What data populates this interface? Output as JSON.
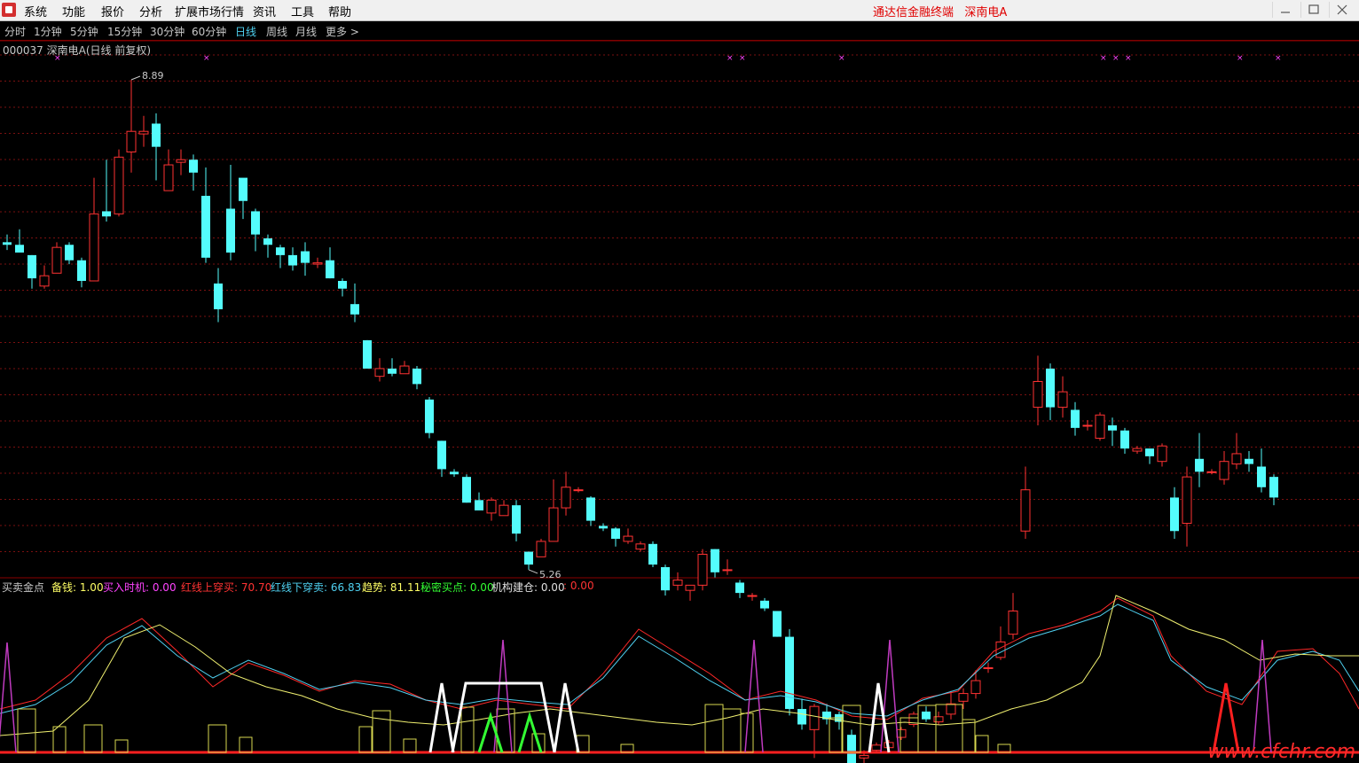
{
  "menu": {
    "items": [
      "系统",
      "功能",
      "报价",
      "分析",
      "扩展市场行情",
      "资讯",
      "工具",
      "帮助"
    ],
    "app_title": "通达信金融终端",
    "stock_title": "深南电A"
  },
  "periods": {
    "items": [
      "分时",
      "1分钟",
      "5分钟",
      "15分钟",
      "30分钟",
      "60分钟",
      "日线",
      "周线",
      "月线",
      "更多 >"
    ],
    "active": "日线"
  },
  "stock": {
    "code_name": "000037 深南电A(日线 前复权)",
    "high_label": "8.89",
    "low_label": "5.26"
  },
  "indicator": {
    "name": "买卖金点",
    "items": [
      {
        "label": "备钱:",
        "value": "1.00",
        "color": "#ffff66"
      },
      {
        "label": "买入时机:",
        "value": "0.00",
        "color": "#ff44ff"
      },
      {
        "label": "红线上穿买:",
        "value": "70.70",
        "color": "#ff3333"
      },
      {
        "label": "红线下穿卖:",
        "value": "66.83",
        "color": "#4fd0f0"
      },
      {
        "label": "趋势:",
        "value": "81.11",
        "color": "#ffff66"
      },
      {
        "label": "秘密买点:",
        "value": "0.00",
        "color": "#33ff33"
      },
      {
        "label": "机构建仓:",
        "value": "0.00",
        "color": "#e0e0e0"
      },
      {
        "label": ":",
        "value": "0.00",
        "color": "#ff3333"
      }
    ]
  },
  "chart_data": {
    "type": "candlestick",
    "ylim": [
      5.1,
      9.1
    ],
    "grid": true,
    "up_color": "#ff3232",
    "down_color": "#54fcfc",
    "candles": [
      [
        7.62,
        7.6,
        7.68,
        7.56
      ],
      [
        7.6,
        7.54,
        7.72,
        7.54
      ],
      [
        7.52,
        7.34,
        7.52,
        7.26
      ],
      [
        7.28,
        7.36,
        7.44,
        7.26
      ],
      [
        7.38,
        7.58,
        7.62,
        7.38
      ],
      [
        7.6,
        7.48,
        7.62,
        7.45
      ],
      [
        7.48,
        7.32,
        7.5,
        7.27
      ],
      [
        7.32,
        7.84,
        8.12,
        7.32
      ],
      [
        7.86,
        7.82,
        8.26,
        7.78
      ],
      [
        7.84,
        8.28,
        8.34,
        7.82
      ],
      [
        8.32,
        8.48,
        8.88,
        8.16
      ],
      [
        8.46,
        8.48,
        8.6,
        8.36
      ],
      [
        8.54,
        8.36,
        8.62,
        8.1
      ],
      [
        8.02,
        8.22,
        8.34,
        8.02
      ],
      [
        8.24,
        8.26,
        8.34,
        8.14
      ],
      [
        8.26,
        8.16,
        8.3,
        8.02
      ],
      [
        7.98,
        7.5,
        8.2,
        7.46
      ],
      [
        7.3,
        7.1,
        7.42,
        7.0
      ],
      [
        7.88,
        7.54,
        8.22,
        7.48
      ],
      [
        8.12,
        7.94,
        8.08,
        7.8
      ],
      [
        7.86,
        7.68,
        7.88,
        7.55
      ],
      [
        7.65,
        7.6,
        7.68,
        7.5
      ],
      [
        7.58,
        7.52,
        7.6,
        7.42
      ],
      [
        7.52,
        7.44,
        7.58,
        7.4
      ],
      [
        7.55,
        7.46,
        7.62,
        7.36
      ],
      [
        7.45,
        7.46,
        7.5,
        7.42
      ],
      [
        7.48,
        7.34,
        7.58,
        7.34
      ],
      [
        7.32,
        7.26,
        7.34,
        7.2
      ],
      [
        7.14,
        7.06,
        7.3,
        7.0
      ],
      [
        6.86,
        6.64,
        6.86,
        6.64
      ],
      [
        6.58,
        6.64,
        6.72,
        6.54
      ],
      [
        6.64,
        6.6,
        6.72,
        6.58
      ],
      [
        6.6,
        6.66,
        6.7,
        6.62
      ],
      [
        6.64,
        6.52,
        6.66,
        6.48
      ],
      [
        6.4,
        6.14,
        6.42,
        6.1
      ],
      [
        6.08,
        5.86,
        6.08,
        5.8
      ],
      [
        5.84,
        5.82,
        5.86,
        5.8
      ],
      [
        5.8,
        5.6,
        5.82,
        5.6
      ],
      [
        5.62,
        5.54,
        5.68,
        5.54
      ],
      [
        5.52,
        5.62,
        5.64,
        5.46
      ],
      [
        5.5,
        5.58,
        5.62,
        5.5
      ],
      [
        5.58,
        5.36,
        5.62,
        5.3
      ],
      [
        5.22,
        5.12,
        5.14,
        5.08
      ],
      [
        5.18,
        5.3,
        5.32,
        5.18
      ],
      [
        5.3,
        5.56,
        5.78,
        5.3
      ],
      [
        5.56,
        5.72,
        5.84,
        5.5
      ],
      [
        5.7,
        5.7,
        5.72,
        5.68
      ],
      [
        5.64,
        5.46,
        5.65,
        5.42
      ],
      [
        5.42,
        5.4,
        5.44,
        5.38
      ],
      [
        5.4,
        5.32,
        5.41,
        5.26
      ],
      [
        5.3,
        5.34,
        5.4,
        5.28
      ],
      [
        5.24,
        5.28,
        5.3,
        5.22
      ],
      [
        5.28,
        5.12,
        5.3,
        5.1
      ],
      [
        5.1,
        4.92,
        5.12,
        4.88
      ],
      [
        4.96,
        5.0,
        5.06,
        4.92
      ],
      [
        4.92,
        4.96,
        4.96,
        4.84
      ],
      [
        4.96,
        5.2,
        5.24,
        4.92
      ],
      [
        5.24,
        5.06,
        5.24,
        5.02
      ],
      [
        5.08,
        5.08,
        5.16,
        5.04
      ],
      [
        4.98,
        4.9,
        5.0,
        4.86
      ],
      [
        4.88,
        4.88,
        4.9,
        4.84
      ],
      [
        4.84,
        4.78,
        4.86,
        4.76
      ],
      [
        4.76,
        4.56,
        4.76,
        4.56
      ],
      [
        4.56,
        4.0,
        4.62,
        3.95
      ],
      [
        4.0,
        3.88,
        4.08,
        3.84
      ],
      [
        3.84,
        4.02,
        4.04,
        3.62
      ],
      [
        3.98,
        3.92,
        4.04,
        3.88
      ],
      [
        3.96,
        3.9,
        3.98,
        3.84
      ],
      [
        3.8,
        3.52,
        3.84,
        3.48
      ],
      [
        3.62,
        3.64,
        3.68,
        3.58
      ],
      [
        3.68,
        3.72,
        3.74,
        3.66
      ],
      [
        3.7,
        3.74,
        3.76,
        3.68
      ],
      [
        3.78,
        3.84,
        3.86,
        3.76
      ],
      [
        3.88,
        3.96,
        3.98,
        3.86
      ],
      [
        3.98,
        3.92,
        4.02,
        3.9
      ],
      [
        3.9,
        3.94,
        3.98,
        3.88
      ],
      [
        3.96,
        4.04,
        4.14,
        3.92
      ],
      [
        4.06,
        4.12,
        4.16,
        4.0
      ],
      [
        4.12,
        4.22,
        4.3,
        4.08
      ],
      [
        4.32,
        4.32,
        4.36,
        4.28
      ],
      [
        4.4,
        4.52,
        4.64,
        4.38
      ],
      [
        4.58,
        4.76,
        4.9,
        4.54
      ],
      [
        5.38,
        5.7,
        5.88,
        5.32
      ],
      [
        6.34,
        6.54,
        6.74,
        6.2
      ],
      [
        6.64,
        6.34,
        6.68,
        6.24
      ],
      [
        6.34,
        6.46,
        6.58,
        6.26
      ],
      [
        6.32,
        6.18,
        6.38,
        6.12
      ],
      [
        6.2,
        6.2,
        6.24,
        6.16
      ],
      [
        6.1,
        6.28,
        6.3,
        6.08
      ],
      [
        6.2,
        6.16,
        6.26,
        6.04
      ],
      [
        6.16,
        6.02,
        6.18,
        5.98
      ],
      [
        6.0,
        6.02,
        6.04,
        5.98
      ],
      [
        6.02,
        5.96,
        6.02,
        5.9
      ],
      [
        5.92,
        6.04,
        6.06,
        5.88
      ],
      [
        5.64,
        5.38,
        5.72,
        5.32
      ],
      [
        5.44,
        5.8,
        5.88,
        5.26
      ],
      [
        5.94,
        5.84,
        6.14,
        5.72
      ],
      [
        5.84,
        5.84,
        5.86,
        5.82
      ],
      [
        5.78,
        5.92,
        6.0,
        5.74
      ],
      [
        5.9,
        5.98,
        6.14,
        5.86
      ],
      [
        5.94,
        5.9,
        6.0,
        5.84
      ],
      [
        5.88,
        5.72,
        6.02,
        5.68
      ],
      [
        5.8,
        5.64,
        5.82,
        5.58
      ]
    ]
  }
}
